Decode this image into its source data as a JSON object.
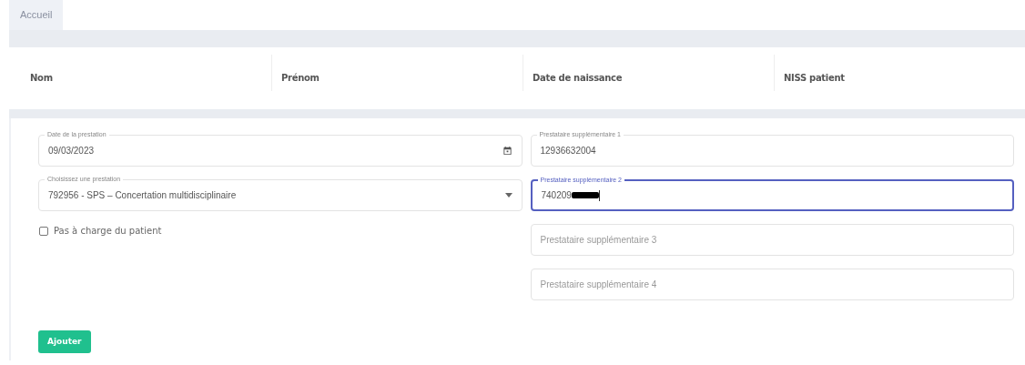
{
  "tabs": [
    {
      "label": "Accueil",
      "selected": true
    }
  ],
  "patient_header": {
    "columns": [
      "Nom",
      "Prénom",
      "Date de naissance",
      "NISS patient"
    ]
  },
  "form": {
    "left_fields": [
      {
        "kind": "date",
        "label": "Date de la prestation",
        "value": "09/03/2023",
        "focused": false
      },
      {
        "kind": "select",
        "label": "Choisissez une prestation",
        "value": "792956 - SPS – Concertation multidisciplinaire",
        "focused": false
      }
    ],
    "checkbox": {
      "label": "Pas à charge du patient",
      "checked": false
    },
    "right_fields": [
      {
        "label": "Prestataire supplémentaire 1",
        "value": "12936632004",
        "focused": false,
        "redacted": false
      },
      {
        "label": "Prestataire supplémentaire 2",
        "value": "740209",
        "focused": true,
        "redacted": true
      },
      {
        "placeholder": "Prestataire supplémentaire 3",
        "focused": false,
        "redacted": false
      },
      {
        "placeholder": "Prestataire supplémentaire 4",
        "focused": false,
        "redacted": false
      }
    ],
    "submit_button": "Ajouter"
  }
}
